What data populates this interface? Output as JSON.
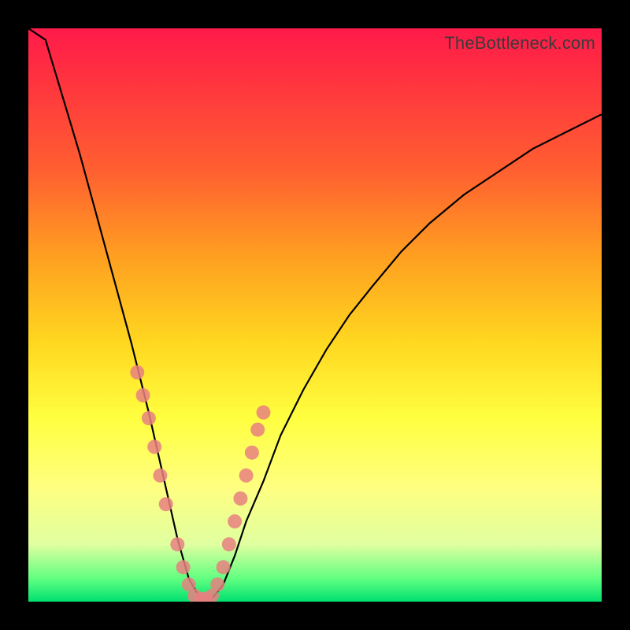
{
  "watermark": "TheBottleneck.com",
  "chart_data": {
    "type": "line",
    "title": "",
    "xlabel": "",
    "ylabel": "",
    "xlim": [
      0,
      100
    ],
    "ylim": [
      0,
      100
    ],
    "series": [
      {
        "name": "bottleneck-curve",
        "x": [
          0,
          3,
          6,
          9,
          12,
          15,
          18,
          21,
          23.5,
          26,
          28,
          30,
          32,
          34,
          36,
          38,
          41,
          44,
          48,
          52,
          56,
          60,
          65,
          70,
          76,
          82,
          88,
          94,
          100
        ],
        "y": [
          108,
          98,
          88,
          78,
          67,
          56,
          45,
          33,
          22,
          11,
          4,
          0.5,
          0.5,
          3,
          8,
          14,
          21,
          29,
          37,
          44,
          50,
          55,
          61,
          66,
          71,
          75,
          79,
          82,
          85
        ]
      }
    ],
    "markers": {
      "name": "highlight-dots",
      "x_approx": [
        19,
        20,
        21,
        22,
        23,
        24,
        26,
        27,
        28,
        29,
        30,
        31,
        32,
        33,
        34,
        35,
        36,
        37,
        38,
        39,
        40,
        41
      ],
      "y_approx": [
        40,
        36,
        32,
        27,
        22,
        17,
        10,
        6,
        3,
        1,
        0.5,
        0.5,
        1,
        3,
        6,
        10,
        14,
        18,
        22,
        26,
        30,
        33
      ]
    },
    "background_gradient": {
      "top": "#ff1a4a",
      "mid": "#ffff40",
      "bottom": "#00e070"
    }
  }
}
